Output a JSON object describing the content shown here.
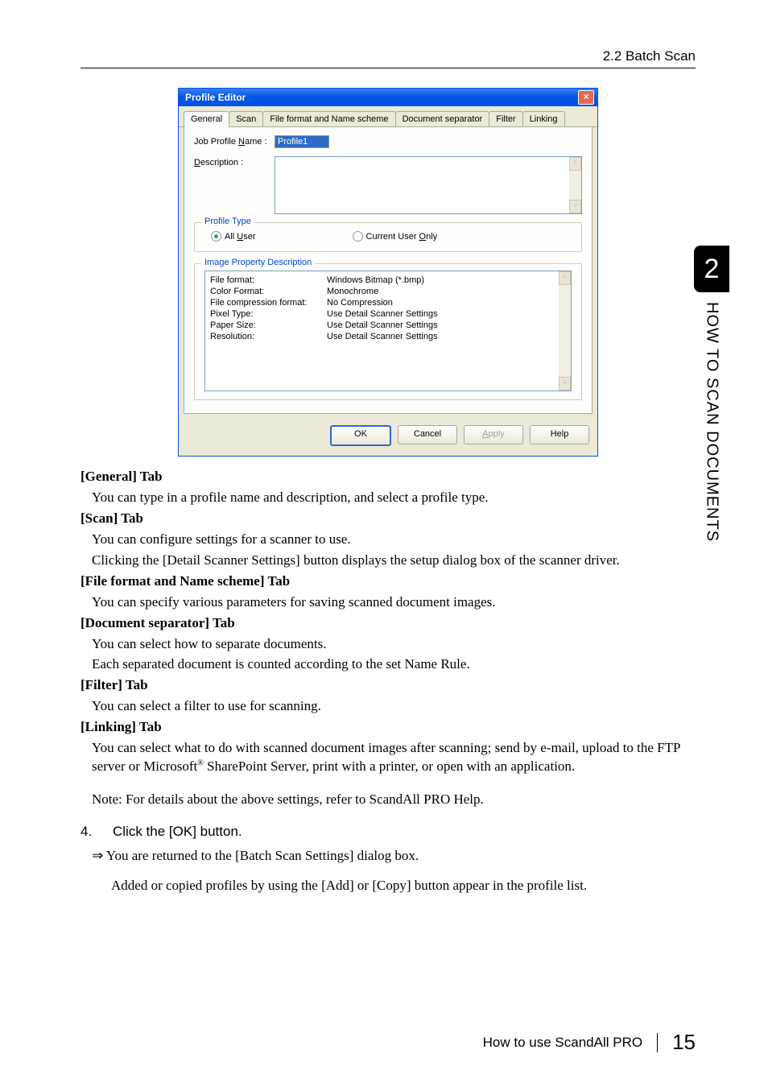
{
  "header": {
    "section": "2.2 Batch Scan"
  },
  "side": {
    "chapter": "2",
    "label": "HOW TO SCAN DOCUMENTS"
  },
  "win": {
    "title": "Profile Editor",
    "tabs": [
      "General",
      "Scan",
      "File format and Name scheme",
      "Document separator",
      "Filter",
      "Linking"
    ],
    "jobProfileLabel": "Job Profile Name :",
    "jobProfileValue": "Profile1",
    "descriptionLabel": "Description :",
    "profileTypeLegend": "Profile Type",
    "allUser": "All User",
    "currentUser": "Current User Only",
    "imagePropLegend": "Image Property Description",
    "propLabels": "File format:\nColor Format:\nFile compression format:\nPixel Type:\nPaper Size:\nResolution:",
    "propValues": "Windows Bitmap (*.bmp)\nMonochrome\nNo Compression\nUse Detail Scanner Settings\nUse Detail Scanner Settings\nUse Detail Scanner Settings",
    "buttons": {
      "ok": "OK",
      "cancel": "Cancel",
      "apply": "Apply",
      "help": "Help"
    }
  },
  "body": {
    "generalHead": "[General] Tab",
    "generalText": "You can type in a profile name and description, and select a profile type.",
    "scanHead": "[Scan] Tab",
    "scanText1": "You can configure settings for a scanner to use.",
    "scanText2": "Clicking the [Detail Scanner Settings] button displays the setup dialog box of the scanner driver.",
    "fileHead": "[File format and Name scheme] Tab",
    "fileText": "You can specify various parameters for saving scanned document images.",
    "docHead": "[Document separator] Tab",
    "docText1": "You can select how to separate documents.",
    "docText2": "Each separated document is counted according to the set Name Rule.",
    "filterHead": "[Filter] Tab",
    "filterText": "You can select a filter to use for scanning.",
    "linkHead": "[Linking] Tab",
    "linkText1": "You can select what to do with scanned document images after scanning; send by e-mail, upload to the FTP server or Microsoft",
    "linkReg": "®",
    "linkText2": " SharePoint Server, print with a printer, or open with an application.",
    "note": "Note: For details about the above settings, refer to ScandAll PRO Help.",
    "stepNum": "4.",
    "stepText": "Click the [OK] button.",
    "arrow": "⇒",
    "arrowText": " You are returned to the [Batch Scan Settings] dialog box.",
    "afterArrow": "Added or copied profiles by using the [Add] or [Copy] button appear in the profile list."
  },
  "footer": {
    "text": "How to use ScandAll PRO",
    "page": "15"
  }
}
